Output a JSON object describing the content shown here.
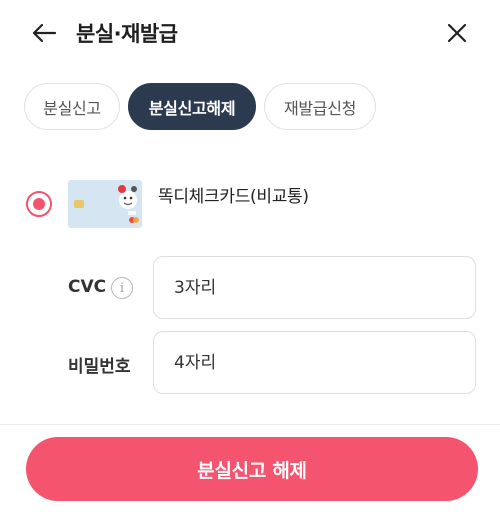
{
  "header": {
    "title": "분실·재발급",
    "back_icon": "arrow-left-icon",
    "close_icon": "close-icon"
  },
  "tabs": [
    {
      "label": "분실신고",
      "selected": false
    },
    {
      "label": "분실신고해제",
      "selected": true
    },
    {
      "label": "재발급신청",
      "selected": false
    }
  ],
  "card": {
    "name": "똑디체크카드(비교통)",
    "selected": true,
    "image_icon": "card-thumbnail"
  },
  "fields": {
    "cvc": {
      "label": "CVC",
      "placeholder": "3자리",
      "info_icon": "info-icon"
    },
    "password": {
      "label": "비밀번호",
      "placeholder": "4자리"
    }
  },
  "submit": {
    "label": "분실신고 해제"
  },
  "colors": {
    "accent": "#f5546f",
    "active_tab": "#2c3a4f"
  }
}
